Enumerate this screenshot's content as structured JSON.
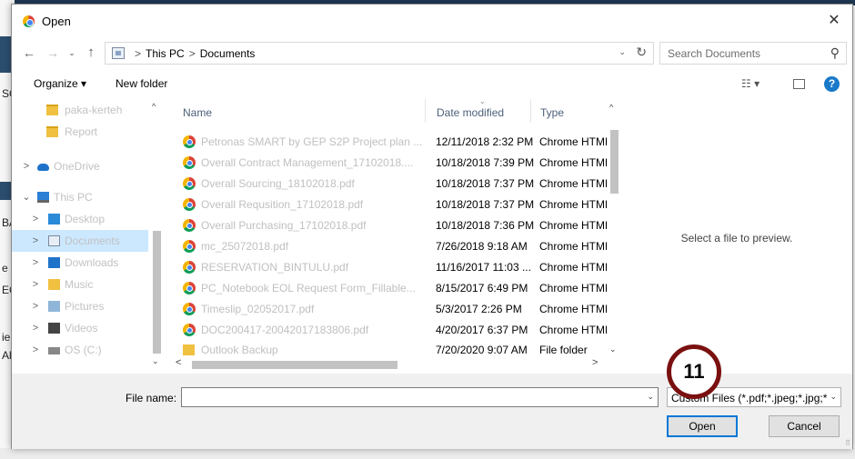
{
  "background": {
    "fragments": [
      "SC",
      "BA",
      "e",
      "EC",
      "ie",
      "Al"
    ]
  },
  "dialog": {
    "title": "Open",
    "close_glyph": "✕"
  },
  "address": {
    "back_glyph": "←",
    "forward_glyph": "→",
    "recent_glyph": "⌄",
    "up_glyph": "↑",
    "path": [
      "This PC",
      "Documents"
    ],
    "separator": ">",
    "dropdown_glyph": "⌄",
    "refresh_glyph": "↻",
    "search_placeholder": "Search Documents",
    "search_glyph": "⚲"
  },
  "toolbar": {
    "organize_label": "Organize ▾",
    "new_folder_label": "New folder",
    "views_label": "☷ ▾",
    "help_label": "?"
  },
  "navpane": {
    "items": [
      {
        "label": "paka-kerteh",
        "chevron": "",
        "icon": "folder-icon"
      },
      {
        "label": "Report",
        "chevron": "",
        "icon": "folder-icon"
      },
      {
        "label": "OneDrive",
        "chevron": ">",
        "icon": "cloud-icon"
      },
      {
        "label": "This PC",
        "chevron": "⌄",
        "icon": "pc-icon"
      },
      {
        "label": "Desktop",
        "chevron": ">",
        "icon": "desktop-icon"
      },
      {
        "label": "Documents",
        "chevron": ">",
        "icon": "documents-icon"
      },
      {
        "label": "Downloads",
        "chevron": ">",
        "icon": "downloads-icon"
      },
      {
        "label": "Music",
        "chevron": ">",
        "icon": "music-icon"
      },
      {
        "label": "Pictures",
        "chevron": ">",
        "icon": "pictures-icon"
      },
      {
        "label": "Videos",
        "chevron": ">",
        "icon": "videos-icon"
      },
      {
        "label": "OS (C:)",
        "chevron": ">",
        "icon": "drive-icon"
      }
    ],
    "scroll_up": "^",
    "scroll_down": "⌄"
  },
  "filelist": {
    "columns": {
      "name": "Name",
      "date": "Date modified",
      "type": "Type"
    },
    "sort_indicator": "⌄",
    "rows": [
      {
        "name": "Petronas SMART by GEP S2P Project plan ...",
        "date": "12/11/2018 2:32 PM",
        "type": "Chrome HTML Document",
        "icon": "chrome-file-icon"
      },
      {
        "name": "Overall Contract Management_17102018....",
        "date": "10/18/2018 7:39 PM",
        "type": "Chrome HTML Document",
        "icon": "chrome-file-icon"
      },
      {
        "name": "Overall Sourcing_18102018.pdf",
        "date": "10/18/2018 7:37 PM",
        "type": "Chrome HTML Document",
        "icon": "chrome-file-icon"
      },
      {
        "name": "Overall Requsition_17102018.pdf",
        "date": "10/18/2018 7:37 PM",
        "type": "Chrome HTML Document",
        "icon": "chrome-file-icon"
      },
      {
        "name": "Overall Purchasing_17102018.pdf",
        "date": "10/18/2018 7:36 PM",
        "type": "Chrome HTML Document",
        "icon": "chrome-file-icon"
      },
      {
        "name": "mc_25072018.pdf",
        "date": "7/26/2018 9:18 AM",
        "type": "Chrome HTML Document",
        "icon": "chrome-file-icon"
      },
      {
        "name": "RESERVATION_BINTULU.pdf",
        "date": "11/16/2017 11:03 ...",
        "type": "Chrome HTML Document",
        "icon": "chrome-file-icon"
      },
      {
        "name": "PC_Notebook EOL Request Form_Fillable...",
        "date": "8/15/2017 6:49 PM",
        "type": "Chrome HTML Document",
        "icon": "chrome-file-icon"
      },
      {
        "name": "Timeslip_02052017.pdf",
        "date": "5/3/2017 2:26 PM",
        "type": "Chrome HTML Document",
        "icon": "chrome-file-icon"
      },
      {
        "name": "DOC200417-20042017183806.pdf",
        "date": "4/20/2017 6:37 PM",
        "type": "Chrome HTML Document",
        "icon": "chrome-file-icon"
      },
      {
        "name": "Outlook Backup",
        "date": "7/20/2020 9:07 AM",
        "type": "File folder",
        "icon": "folder-icon"
      }
    ],
    "scroll_up": "^",
    "scroll_down": "⌄",
    "scroll_left": "<",
    "scroll_right": ">"
  },
  "preview": {
    "message": "Select a file to preview."
  },
  "bottom": {
    "file_name_label": "File name:",
    "file_name_value": "",
    "file_name_drop": "⌄",
    "file_type_value": "Custom Files (*.pdf;*.jpeg;*.jpg;*",
    "file_type_drop": "⌄",
    "open_label": "Open",
    "cancel_label": "Cancel",
    "grip": "⠿"
  },
  "annotation": {
    "step_number": "11"
  }
}
